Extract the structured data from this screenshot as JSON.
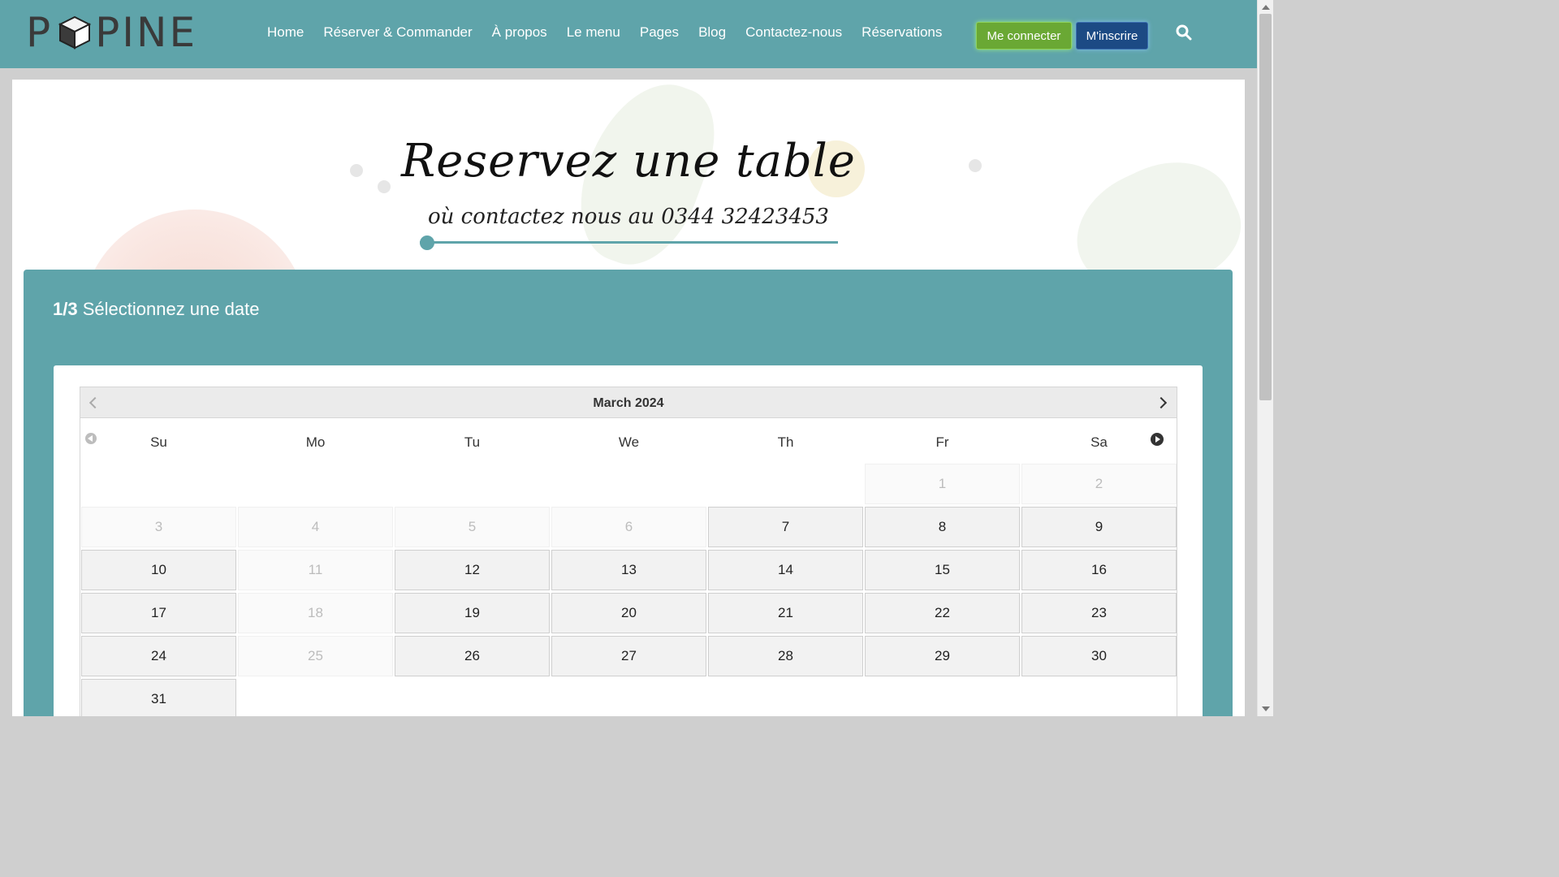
{
  "header": {
    "logo_text": "PPINE",
    "nav": [
      "Home",
      "Réserver & Commander",
      "À propos",
      "Le menu",
      "Pages",
      "Blog",
      "Contactez-nous",
      "Réservations"
    ],
    "login_label": "Me connecter",
    "signup_label": "M'inscrire",
    "search_icon": "search-icon",
    "colors": {
      "bar": "#5fa4aa",
      "login": "#6aa834",
      "signup": "#1c4a84"
    }
  },
  "hero": {
    "title": "Reservez une table",
    "subtitle": "où contactez nous au 0344 32423453"
  },
  "booking": {
    "step_num": "1/3",
    "step_label": "Sélectionnez une date",
    "calendar": {
      "month": "March 2024",
      "weekdays": [
        "Su",
        "Mo",
        "Tu",
        "We",
        "Th",
        "Fr",
        "Sa"
      ],
      "days": [
        "1",
        "2",
        "3",
        "4",
        "5",
        "6",
        "7",
        "8",
        "9",
        "10",
        "11",
        "12",
        "13",
        "14",
        "15",
        "16",
        "17",
        "18",
        "19",
        "20",
        "21",
        "22",
        "23",
        "24",
        "25",
        "26",
        "27",
        "28",
        "29",
        "30",
        "31"
      ],
      "unavailable": [
        "1",
        "2",
        "3",
        "4",
        "5",
        "6",
        "11",
        "18",
        "25"
      ]
    }
  }
}
